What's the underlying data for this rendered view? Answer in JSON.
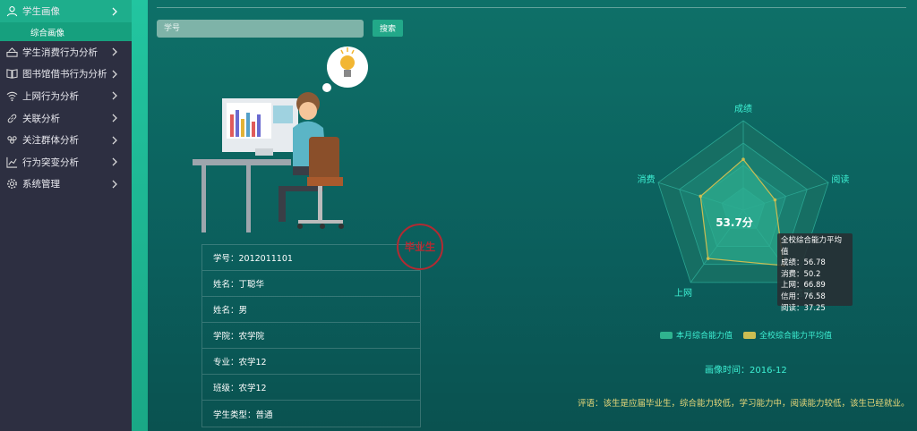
{
  "sidebar": {
    "items": [
      {
        "label": "学生画像",
        "icon": "user-icon"
      },
      {
        "label": "学生消费行为分析",
        "icon": "consume-icon"
      },
      {
        "label": "图书馆借书行为分析",
        "icon": "book-icon"
      },
      {
        "label": "上网行为分析",
        "icon": "wifi-icon"
      },
      {
        "label": "关联分析",
        "icon": "link-icon"
      },
      {
        "label": "关注群体分析",
        "icon": "group-icon"
      },
      {
        "label": "行为突变分析",
        "icon": "trend-icon"
      },
      {
        "label": "系统管理",
        "icon": "gear-icon"
      }
    ],
    "sub_item": "综合画像"
  },
  "search": {
    "placeholder": "学号",
    "button_label": "搜索"
  },
  "student": {
    "rows": [
      "学号：2012011101",
      "姓名：丁聪华",
      "姓名：男",
      "学院：农学院",
      "专业：农学12",
      "班级：农学12",
      "学生类型：普通"
    ],
    "stamp": "毕业生"
  },
  "radar": {
    "axes": [
      "成绩",
      "阅读",
      "信用",
      "上网",
      "消费"
    ],
    "score": "53.7分",
    "legend": [
      "本月综合能力值",
      "全校综合能力平均值"
    ],
    "colors": {
      "month": "#2fb38f",
      "avg": "#cbbd52"
    }
  },
  "tooltip": {
    "title": "全校综合能力平均值",
    "lines": [
      "成绩：56.78",
      "消费：50.2",
      "上网：66.89",
      "信用：76.58",
      "阅读：37.25"
    ]
  },
  "portrait_time": "画像时间：2016-12",
  "comment": "评语：该生是应届毕业生，综合能力较低，学习能力中，阅读能力较低，该生已经就业。",
  "chart_data": {
    "type": "radar",
    "categories": [
      "成绩",
      "阅读",
      "信用",
      "上网",
      "消费"
    ],
    "series": [
      {
        "name": "全校综合能力平均值",
        "values": [
          56.78,
          37.25,
          76.58,
          66.89,
          50.2
        ]
      }
    ],
    "score": 53.7
  }
}
